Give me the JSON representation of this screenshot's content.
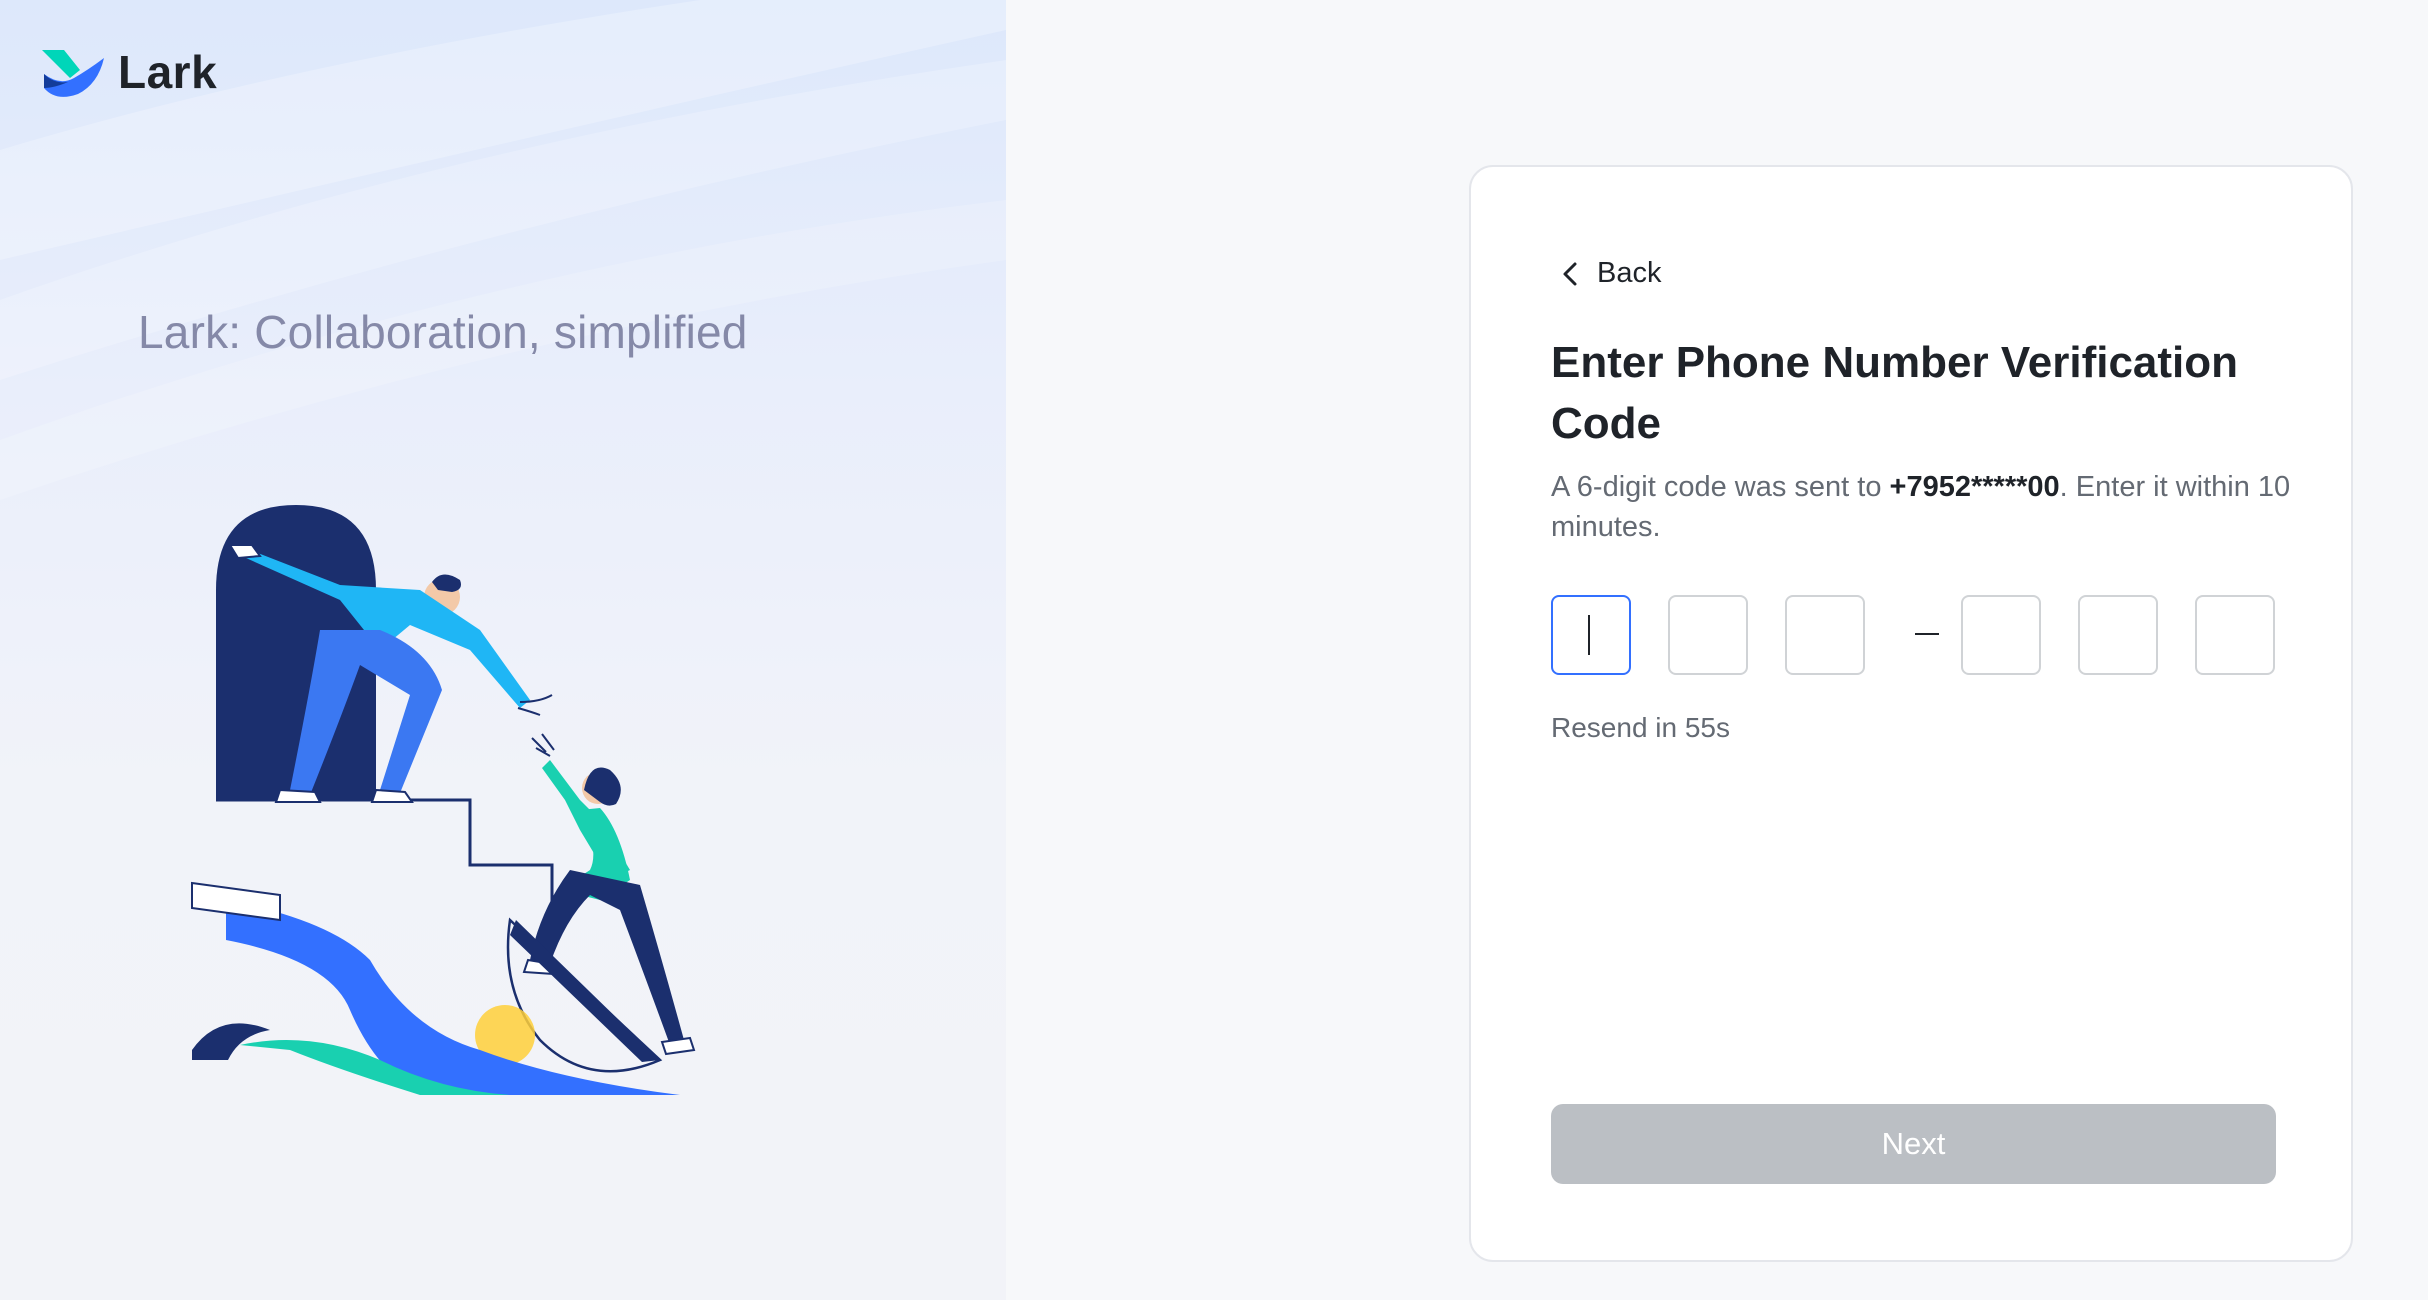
{
  "brand": {
    "name": "Lark",
    "tagline": "Lark: Collaboration, simplified"
  },
  "verification": {
    "back_label": "Back",
    "title": "Enter Phone Number Verification Code",
    "desc_prefix": "A 6-digit code was sent to ",
    "phone": "+7952*****00",
    "desc_suffix": ". Enter it within 10 minutes.",
    "code_digits": [
      "",
      "",
      "",
      "",
      "",
      ""
    ],
    "resend_text": "Resend in 55s",
    "next_label": "Next"
  },
  "colors": {
    "accent": "#3370ff",
    "disabled_button": "#bbbfc4",
    "title": "#1f2329",
    "muted": "#646a73",
    "tagline": "#8589a8"
  },
  "icons": {
    "logo": "lark-bird-logo-icon",
    "back": "chevron-left-icon"
  }
}
